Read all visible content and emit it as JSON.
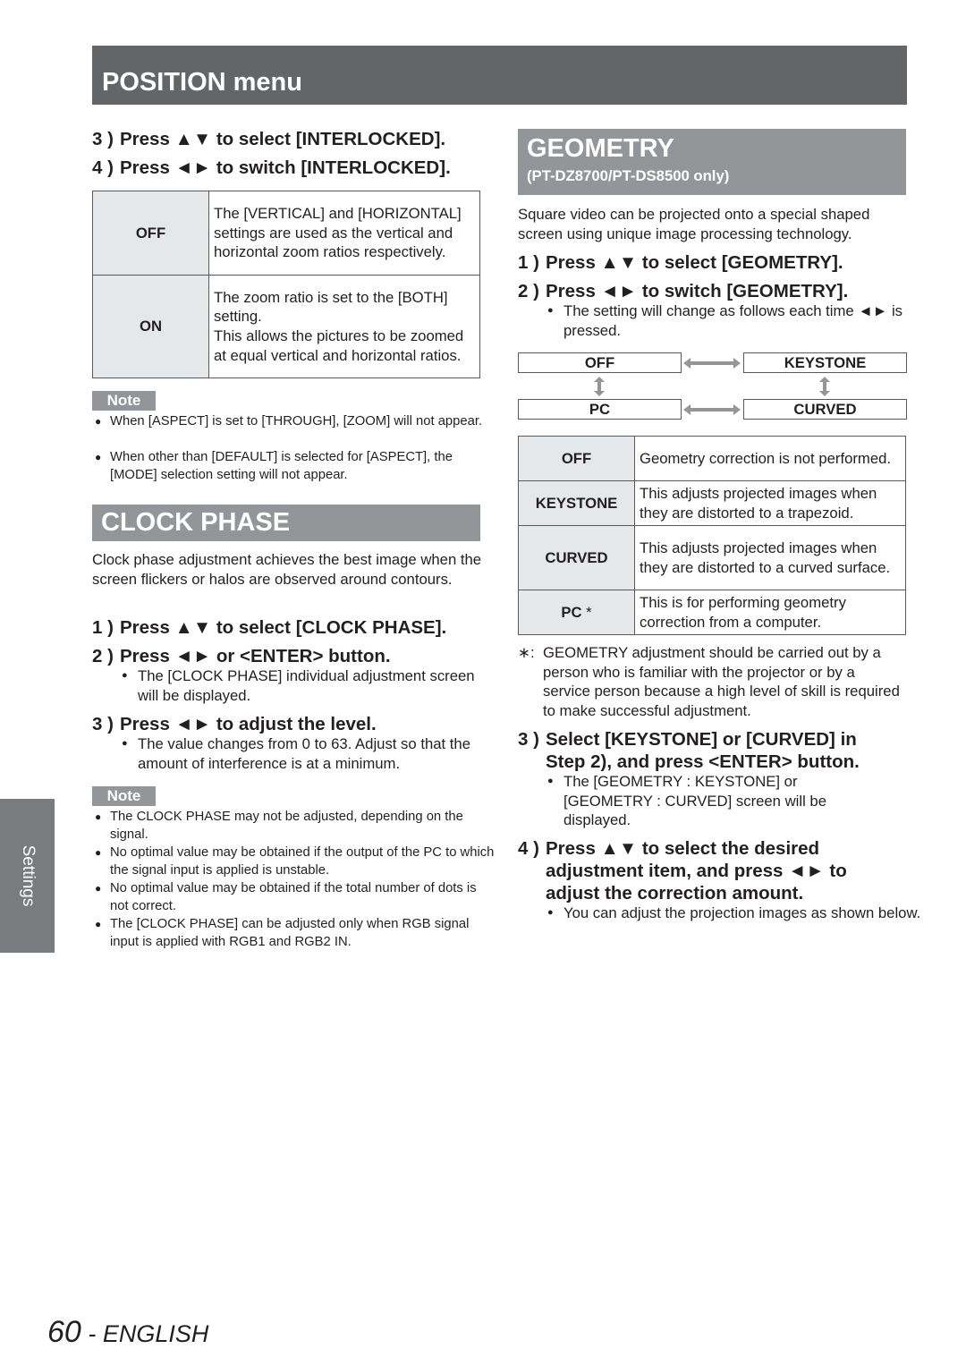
{
  "header": {
    "title": "POSITION menu"
  },
  "side_tab": {
    "label": "Settings"
  },
  "left_column": {
    "interlocked_steps": [
      {
        "num": "3 )",
        "text": "Press ▲▼ to select [INTERLOCKED]."
      },
      {
        "num": "4 )",
        "text": "Press ◄► to switch [INTERLOCKED]."
      }
    ],
    "interlocked_table": [
      {
        "key": "OFF",
        "desc": "The [VERTICAL] and [HORIZONTAL] settings are used as the vertical and horizontal zoom ratios respectively."
      },
      {
        "key": "ON",
        "desc_lines": [
          "The zoom ratio is set to the [BOTH] setting.",
          "This allows the pictures to be zoomed at equal vertical and horizontal ratios."
        ]
      }
    ],
    "note1": {
      "label": "Note",
      "items": [
        "When [ASPECT] is set to [THROUGH], [ZOOM] will not appear.",
        "When other than [DEFAULT] is selected for [ASPECT], the [MODE] selection setting will not appear."
      ]
    },
    "clock_phase": {
      "title": "CLOCK PHASE",
      "intro": "Clock phase adjustment achieves the best image when the screen flickers or halos are observed around contours.",
      "steps": [
        {
          "num": "1 )",
          "text": "Press ▲▼ to select [CLOCK PHASE]."
        },
        {
          "num": "2 )",
          "text": "Press ◄► or <ENTER> button.",
          "bullet": "The [CLOCK PHASE] individual adjustment screen will be displayed."
        },
        {
          "num": "3 )",
          "text": "Press ◄► to adjust the level.",
          "bullet": "The value changes from 0 to 63. Adjust so that the amount of interference is at a minimum."
        }
      ],
      "note": {
        "label": "Note",
        "items": [
          "The CLOCK PHASE may not be adjusted, depending on the signal.",
          "No optimal value may be obtained if the output of the PC to which the signal input is applied is unstable.",
          "No optimal value may be obtained if the total number of dots is not correct.",
          "The [CLOCK PHASE] can be adjusted only when RGB signal input is applied with RGB1 and RGB2 IN."
        ]
      }
    }
  },
  "right_column": {
    "geometry": {
      "title": "GEOMETRY",
      "subtitle": "(PT-DZ8700/PT-DS8500 only)",
      "intro": "Square video can be projected onto a special shaped screen using unique image processing technology.",
      "steps": [
        {
          "num": "1 )",
          "text": "Press ▲▼ to select [GEOMETRY]."
        },
        {
          "num": "2 )",
          "text": "Press ◄► to switch [GEOMETRY].",
          "bullet": "The setting will change as follows each time ◄► is pressed."
        }
      ],
      "flow": {
        "top_left": "OFF",
        "top_right": "KEYSTONE",
        "bottom_left": "PC",
        "bottom_right": "CURVED"
      },
      "table": [
        {
          "key": "OFF",
          "mark": "",
          "desc": "Geometry correction is not performed."
        },
        {
          "key": "KEYSTONE",
          "mark": "",
          "desc": "This adjusts projected images when they are distorted to a trapezoid."
        },
        {
          "key": "CURVED",
          "mark": "",
          "desc": "This adjusts projected images when they are distorted to a curved surface."
        },
        {
          "key": "PC",
          "mark": "*",
          "desc": "This is for performing geometry correction from a computer."
        }
      ],
      "footnote_mark": "∗:",
      "footnote": "GEOMETRY adjustment should be carried out by a person who is familiar with the projector or by a service person because a high level of skill is required to make successful adjustment.",
      "steps_after": [
        {
          "num": "3 )",
          "text": "Select [KEYSTONE] or [CURVED] in Step 2), and press <ENTER> button.",
          "bullet": "The [GEOMETRY : KEYSTONE] or [GEOMETRY : CURVED] screen will be displayed."
        },
        {
          "num": "4 )",
          "text": "Press ▲▼ to select the desired adjustment item, and press ◄► to adjust the correction amount.",
          "bullet": "You can adjust the projection images as shown below."
        }
      ]
    }
  },
  "footer": {
    "page_number": "60",
    "separator": " - ",
    "language": "ENGLISH"
  }
}
